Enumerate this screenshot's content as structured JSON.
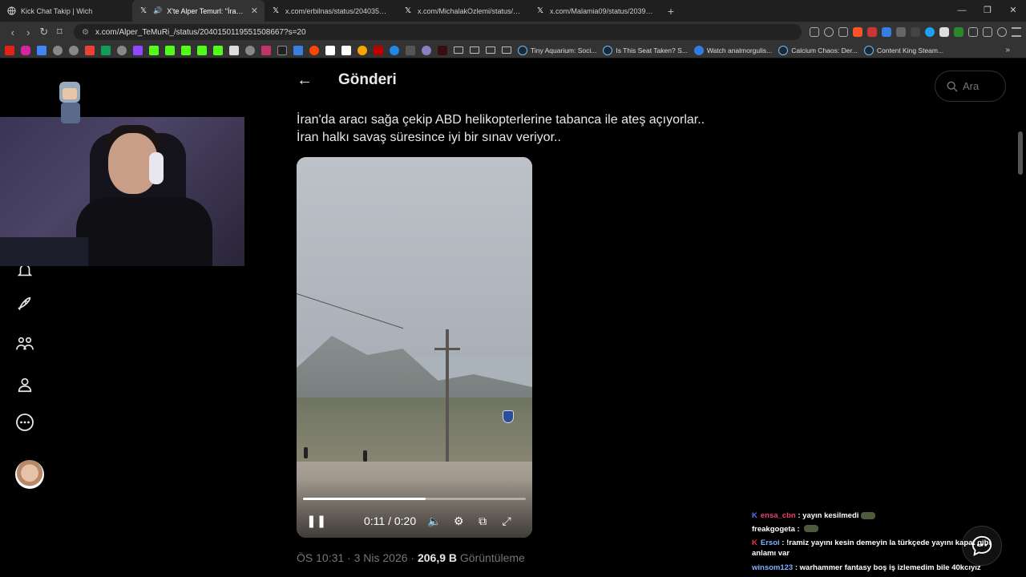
{
  "browser": {
    "tabs": [
      {
        "title": "Kick Chat Takip | Wich",
        "icon": "globe-icon",
        "active": false
      },
      {
        "title": "X'te Alper Temurl: \"İran'da ara",
        "icon": "x-logo-icon",
        "active": true,
        "audio": true
      },
      {
        "title": "x.com/erbilnas/status/204035993710",
        "icon": "x-logo-icon",
        "active": false
      },
      {
        "title": "x.com/MichalakOzlemi/status/20397",
        "icon": "x-logo-icon",
        "active": false
      },
      {
        "title": "x.com/Malamia09/status/203975539",
        "icon": "x-logo-icon",
        "active": false
      }
    ],
    "new_tab": "+",
    "url": "x.com/Alper_TeMuRi_/status/2040150119551508667?s=20",
    "bookmarks": [
      {
        "label": "Tiny Aquarium: Soci..."
      },
      {
        "label": "Is This Seat Taken? S..."
      },
      {
        "label": "Watch analmorgulis..."
      },
      {
        "label": "Calcium Chaos: Der..."
      },
      {
        "label": "Content King Steam..."
      }
    ],
    "bookmark_more": "»"
  },
  "page": {
    "header_title": "Gönderi",
    "search_placeholder": "Ara",
    "tweet_line1": "İran'da aracı sağa çekip ABD helikopterlerine  tabanca ile ateş açıyorlar..",
    "tweet_line2": "İran halkı savaş süresince iyi bir sınav veriyor..",
    "video": {
      "time": "0:11 / 0:20",
      "progress": 0.55
    },
    "meta_time": "ÖS 10:31 · 3 Nis 2026 · ",
    "meta_views": "206,9 B",
    "meta_views_label": " Görüntüleme"
  },
  "chat": {
    "messages": [
      {
        "user": "ensa_cbn",
        "text": "yayın kesilmedi"
      },
      {
        "user": "freakgogeta",
        "text": ""
      },
      {
        "user": "Ersoi",
        "text": "!ramiz yayını kesin demeyin la türkçede yayını kapat gibi anlamı var"
      },
      {
        "user": "winsom123",
        "text": "warhammer fantasy boş iş izlemedim bile 40kcıyız"
      }
    ]
  },
  "colors": {
    "background": "#000000",
    "text_primary": "#e7e9ea",
    "text_secondary": "#71767b",
    "kick_green": "#53fc18"
  }
}
